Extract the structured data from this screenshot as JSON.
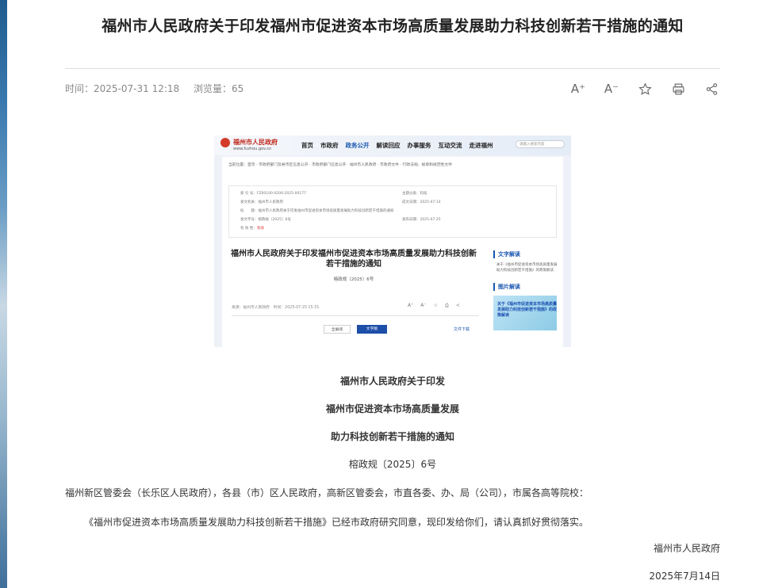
{
  "article": {
    "title": "福州市人民政府关于印发福州市促进资本市场高质量发展助力科技创新若干措施的通知",
    "time_label": "时间：",
    "time_value": "2025-07-31 12:18",
    "views_label": "浏览量：",
    "views_value": "65"
  },
  "toolbar": {
    "increase_font": "A⁺",
    "decrease_font": "A⁻"
  },
  "screenshot": {
    "logo_text": "福州市人民政府",
    "logo_url": "www.fuzhou.gov.cn",
    "nav": [
      "首页",
      "市政府",
      "政务公开",
      "解读回应",
      "办事服务",
      "互动交流",
      "走进福州"
    ],
    "nav_active": "政务公开",
    "search_placeholder": "请输入搜索内容",
    "breadcrumb": "当前位置：首页 · 市政府部门及县市区信息公开 · 市政府部门信息公开 · 福州市人民政府 · 市政府文件 · 行政法规、规章和规范性文件",
    "info_rows": [
      {
        "label": "索 引 号：",
        "value": "FZ00100-0200-2025-00177"
      },
      {
        "label": "发文机关：",
        "value": "福州市人民政府"
      },
      {
        "label": "标　　题：",
        "value": "福州市人民政府关于印发福州市促进资本市场高质量发展助力科技创新若干措施的通知"
      },
      {
        "label": "发文字号：",
        "value": "榕政规〔2025〕6号"
      },
      {
        "label": "有 效 性：",
        "value": "有效"
      }
    ],
    "info_right": [
      {
        "label": "主题分类：",
        "value": "科技"
      },
      {
        "label": "成文日期：",
        "value": "2025-07-14"
      },
      {
        "label": "发布日期：",
        "value": "2025-07-25"
      }
    ],
    "doc_title": "福州市人民政府关于印发福州市促进资本市场高质量发展助力科技创新若干措施的通知",
    "doc_no": "榕政规〔2025〕6号",
    "meta": "来源：福州市人民政府　时间：2025-07-25 15:31",
    "btn_full": "全屏阅",
    "btn_text": "文字版",
    "download": "文件下载",
    "side_text_head": "文字解读",
    "side_text_item": "关于《福州市促进资本市场高质量发展助力科技创新若干措施》的政策解读",
    "side_pic_head": "图片解读",
    "side_pic_text": "关于《福州市促进资本市场高质量发展助力科技创新若干措施》的政策解读"
  },
  "document": {
    "heading1": "福州市人民政府关于印发",
    "heading2": "福州市促进资本市场高质量发展",
    "heading3": "助力科技创新若干措施的通知",
    "doc_number": "榕政规〔2025〕6号",
    "recipients": "福州新区管委会（长乐区人民政府），各县（市）区人民政府，高新区管委会，市直各委、办、局（公司），市属各高等院校：",
    "body": "《福州市促进资本市场高质量发展助力科技创新若干措施》已经市政府研究同意，现印发给你们，请认真抓好贯彻落实。",
    "issuer": "福州市人民政府",
    "date": "2025年7月14日"
  }
}
